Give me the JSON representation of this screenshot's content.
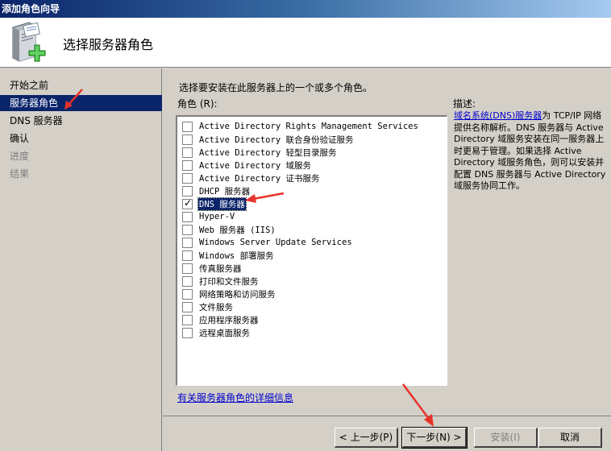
{
  "window": {
    "title": "添加角色向导"
  },
  "header": {
    "title": "选择服务器角色"
  },
  "sidebar": {
    "items": [
      {
        "label": "开始之前",
        "state": "normal"
      },
      {
        "label": "服务器角色",
        "state": "active"
      },
      {
        "label": "DNS 服务器",
        "state": "normal"
      },
      {
        "label": "确认",
        "state": "normal"
      },
      {
        "label": "进度",
        "state": "disabled"
      },
      {
        "label": "结果",
        "state": "disabled"
      }
    ]
  },
  "main": {
    "instruction": "选择要安装在此服务器上的一个或多个角色。",
    "roles_label": "角色 (R):",
    "roles": [
      {
        "label": "Active Directory Rights Management Services",
        "checked": false
      },
      {
        "label": "Active Directory 联合身份验证服务",
        "checked": false
      },
      {
        "label": "Active Directory 轻型目录服务",
        "checked": false
      },
      {
        "label": "Active Directory 域服务",
        "checked": false
      },
      {
        "label": "Active Directory 证书服务",
        "checked": false
      },
      {
        "label": "DHCP 服务器",
        "checked": false
      },
      {
        "label": "DNS 服务器",
        "checked": true
      },
      {
        "label": "Hyper-V",
        "checked": false
      },
      {
        "label": "Web 服务器 (IIS)",
        "checked": false
      },
      {
        "label": "Windows Server Update Services",
        "checked": false
      },
      {
        "label": "Windows 部署服务",
        "checked": false
      },
      {
        "label": "传真服务器",
        "checked": false
      },
      {
        "label": "打印和文件服务",
        "checked": false
      },
      {
        "label": "网络策略和访问服务",
        "checked": false
      },
      {
        "label": "文件服务",
        "checked": false
      },
      {
        "label": "应用程序服务器",
        "checked": false
      },
      {
        "label": "远程桌面服务",
        "checked": false
      }
    ],
    "description_label": "描述:",
    "description_link": "域名系统(DNS)服务器",
    "description_text": "为 TCP/IP 网络提供名称解析。DNS 服务器与 Active Directory 域服务安装在同一服务器上时更易于管理。如果选择 Active Directory 域服务角色，则可以安装并配置 DNS 服务器与 Active Directory 域服务协同工作。",
    "more_info_link": "有关服务器角色的详细信息"
  },
  "footer": {
    "back_label": "< 上一步(P)",
    "next_label": "下一步(N) >",
    "install_label": "安装(I)",
    "cancel_label": "取消"
  },
  "colors": {
    "selection": "#0a246a",
    "link": "#0000cc",
    "annotation_arrow": "#e8332a"
  }
}
